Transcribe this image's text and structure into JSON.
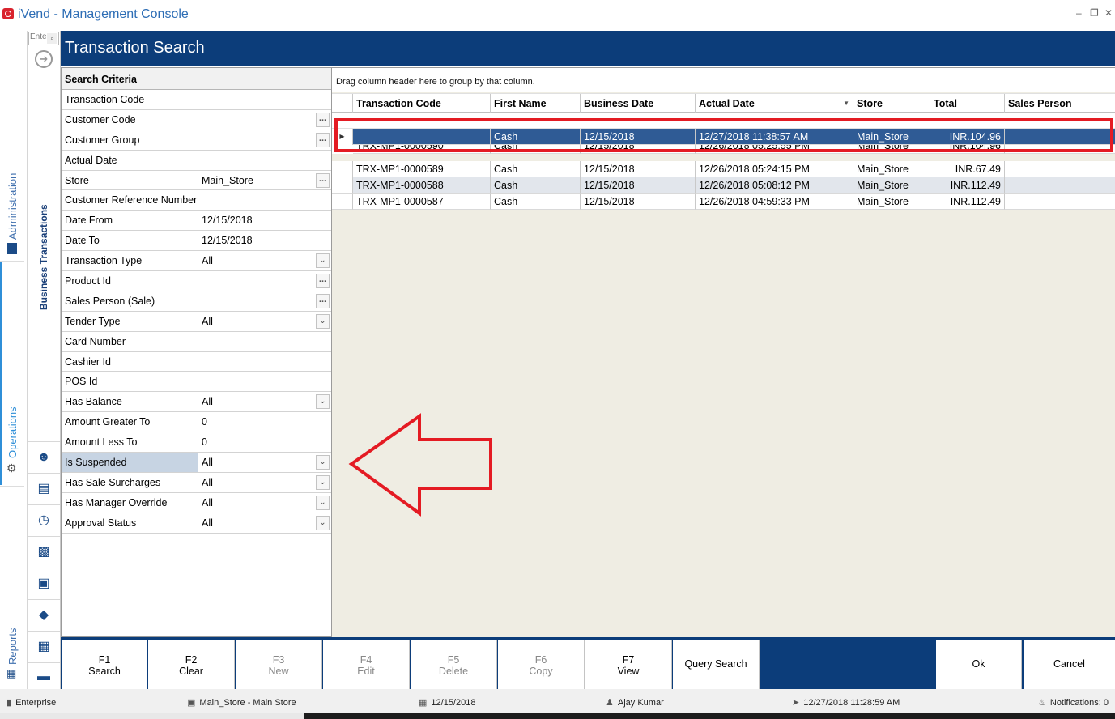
{
  "window": {
    "title": "iVend - Management Console"
  },
  "side_tabs": {
    "administration": "Administration",
    "operations": "Operations",
    "reports": "Reports"
  },
  "rail": {
    "search_placeholder": "Ente",
    "section_label": "Business Transactions"
  },
  "header": {
    "title": "Transaction Search"
  },
  "criteria": {
    "heading": "Search Criteria",
    "rows": [
      {
        "label": "Transaction Code",
        "value": ""
      },
      {
        "label": "Customer Code",
        "value": ""
      },
      {
        "label": "Customer Group",
        "value": ""
      },
      {
        "label": "Actual Date",
        "value": ""
      },
      {
        "label": "Store",
        "value": "Main_Store"
      },
      {
        "label": "Customer Reference Number",
        "value": ""
      },
      {
        "label": "Date From",
        "value": "12/15/2018"
      },
      {
        "label": "Date To",
        "value": "12/15/2018"
      },
      {
        "label": "Transaction Type",
        "value": "All"
      },
      {
        "label": "Product Id",
        "value": ""
      },
      {
        "label": "Sales Person (Sale)",
        "value": ""
      },
      {
        "label": "Tender Type",
        "value": "All"
      },
      {
        "label": "Card Number",
        "value": ""
      },
      {
        "label": "Cashier Id",
        "value": ""
      },
      {
        "label": "POS Id",
        "value": ""
      },
      {
        "label": "Has Balance",
        "value": "All"
      },
      {
        "label": "Amount Greater To",
        "value": "0"
      },
      {
        "label": "Amount Less To",
        "value": "0"
      },
      {
        "label": "Is Suspended",
        "value": "All"
      },
      {
        "label": "Has Sale Surcharges",
        "value": "All"
      },
      {
        "label": "Has Manager Override",
        "value": "All"
      },
      {
        "label": "Approval Status",
        "value": "All"
      }
    ]
  },
  "results": {
    "group_hint": "Drag column header here to group by that column.",
    "columns": [
      "Transaction Code",
      "First Name",
      "Business Date",
      "Actual Date",
      "Store",
      "Total",
      "Sales Person"
    ],
    "rows": [
      [
        "",
        "Cash",
        "12/15/2018",
        "12/27/2018 11:38:57 AM",
        "Main_Store",
        "INR.104.96",
        ""
      ],
      [
        "TRX-MP1-0000590",
        "Cash",
        "12/15/2018",
        "12/26/2018 05:25:55 PM",
        "Main_Store",
        "INR.104.96",
        ""
      ],
      [
        "TRX-MP1-0000589",
        "Cash",
        "12/15/2018",
        "12/26/2018 05:24:15 PM",
        "Main_Store",
        "INR.67.49",
        ""
      ],
      [
        "TRX-MP1-0000588",
        "Cash",
        "12/15/2018",
        "12/26/2018 05:08:12 PM",
        "Main_Store",
        "INR.112.49",
        ""
      ],
      [
        "TRX-MP1-0000587",
        "Cash",
        "12/15/2018",
        "12/26/2018 04:59:33 PM",
        "Main_Store",
        "INR.112.49",
        ""
      ]
    ]
  },
  "toolbar": {
    "f1": {
      "key": "F1",
      "label": "Search"
    },
    "f2": {
      "key": "F2",
      "label": "Clear"
    },
    "f3": {
      "key": "F3",
      "label": "New"
    },
    "f4": {
      "key": "F4",
      "label": "Edit"
    },
    "f5": {
      "key": "F5",
      "label": "Delete"
    },
    "f6": {
      "key": "F6",
      "label": "Copy"
    },
    "f7": {
      "key": "F7",
      "label": "View"
    },
    "query_search": "Query Search",
    "ok": "Ok",
    "cancel": "Cancel"
  },
  "status": {
    "edition": "Enterprise",
    "store": "Main_Store - Main Store",
    "date": "12/15/2018",
    "user": "Ajay Kumar",
    "login_time": "12/27/2018 11:28:59 AM",
    "notifications": "Notifications: 0"
  },
  "colors": {
    "header": "#0c3d7a",
    "selected_row": "#2f5b95",
    "annotation_red": "#e41b23"
  }
}
